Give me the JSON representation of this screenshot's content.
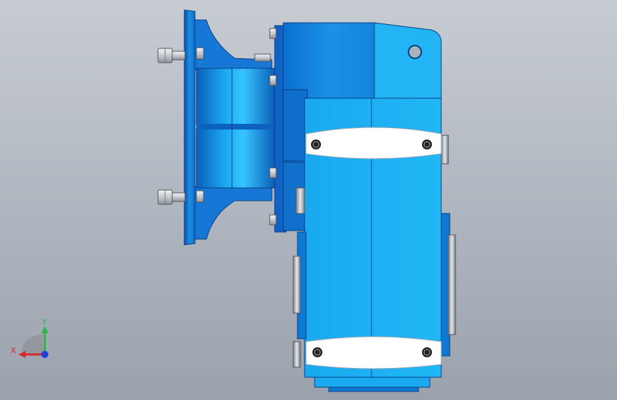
{
  "viewport": {
    "background_top": "#c7ccd3",
    "background_bottom": "#9aa2ad"
  },
  "model": {
    "body_color": "#1eb3f2",
    "body_shade": "#0f8ed8",
    "body_dark": "#0b5fb8",
    "highlight_band": "#ffffff",
    "bolt_color": "#cfd3d8"
  },
  "triad": {
    "x_label": "X",
    "y_label": "Y",
    "x_color": "#d9282a",
    "y_color": "#2fb24a",
    "z_color": "#1d3fd8"
  }
}
